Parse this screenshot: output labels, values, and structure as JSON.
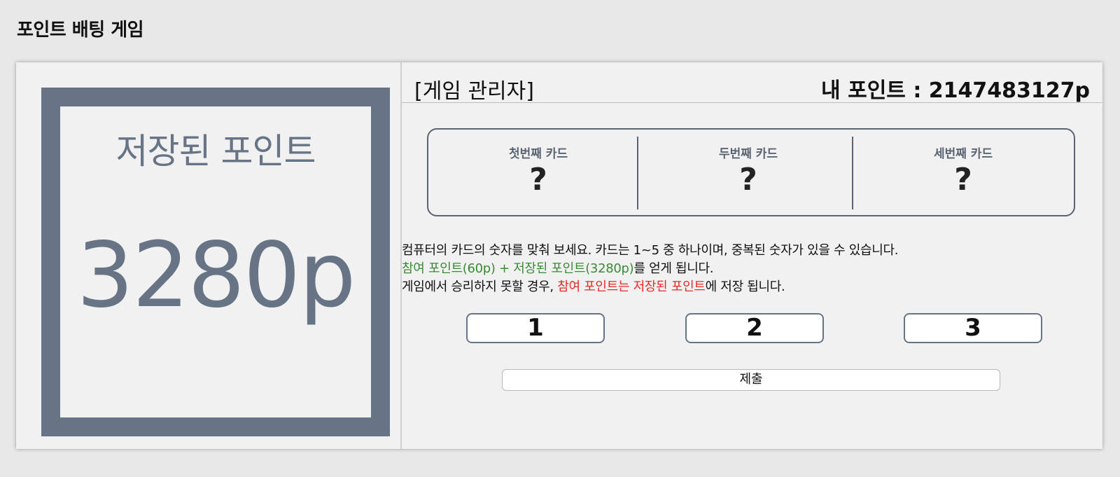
{
  "page": {
    "title": "포인트 배팅 게임"
  },
  "saved": {
    "label": "저장된 포인트",
    "value": "3280p"
  },
  "header": {
    "admin_label": "[게임 관리자]",
    "my_points": "내 포인트 : 2147483127p"
  },
  "cards": [
    {
      "title": "첫번째 카드",
      "value": "?"
    },
    {
      "title": "두번째 카드",
      "value": "?"
    },
    {
      "title": "세번째 카드",
      "value": "?"
    }
  ],
  "description": {
    "line1": "컴퓨터의 카드의 숫자를 맞춰 보세요. 카드는 1~5 중 하나이며, 중복된 숫자가 있을 수 있습니다.",
    "line2_green": "참여 포인트(60p) + 저장된 포인트(3280p)",
    "line2_rest": "를 얻게 됩니다.",
    "line3_start": "게임에서 승리하지 못할 경우, ",
    "line3_red": "참여 포인트는 저장된 포인트",
    "line3_end": "에 저장 됩니다."
  },
  "number_buttons": [
    "1",
    "2",
    "3"
  ],
  "submit_label": "제출",
  "colors": {
    "slate": "#677486",
    "green_text": "#3a8a36",
    "red_text": "#e42a2a",
    "background": "#e8e8e8",
    "panel": "#f1f1f1"
  }
}
